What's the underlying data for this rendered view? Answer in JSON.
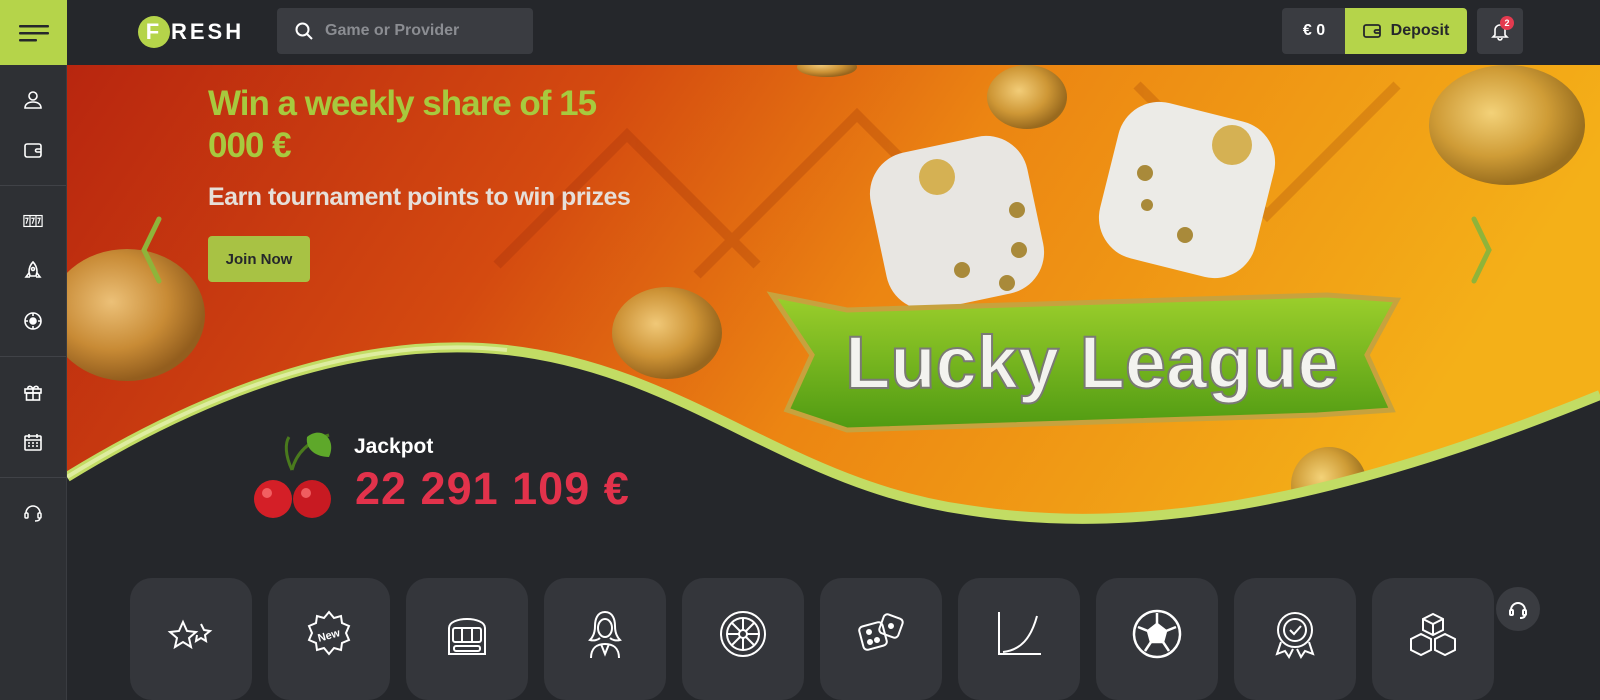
{
  "header": {
    "logo_letter": "F",
    "logo_rest": "RESH",
    "search_placeholder": "Game or Provider",
    "balance": "€ 0",
    "deposit_label": "Deposit",
    "notification_count": "2"
  },
  "sidebar": {
    "items": [
      {
        "icon": "user-icon"
      },
      {
        "icon": "wallet-icon"
      },
      {
        "icon": "slots-777-icon"
      },
      {
        "icon": "rocket-icon"
      },
      {
        "icon": "casino-chip-icon"
      },
      {
        "icon": "gift-icon"
      },
      {
        "icon": "calendar-icon"
      },
      {
        "icon": "support-24-icon"
      }
    ]
  },
  "banner": {
    "title": "Win a weekly share of 15 000 €",
    "subtitle": "Earn tournament points to win prizes",
    "cta": "Join Now",
    "league_name": "Lucky League",
    "jackpot_label": "Jackpot",
    "jackpot_value": "22 291 109 €"
  },
  "categories": [
    {
      "icon": "stars-icon"
    },
    {
      "icon": "new-badge-icon"
    },
    {
      "icon": "slot-machine-icon"
    },
    {
      "icon": "live-dealer-icon"
    },
    {
      "icon": "roulette-icon"
    },
    {
      "icon": "dice-icon"
    },
    {
      "icon": "crash-curve-icon"
    },
    {
      "icon": "football-icon"
    },
    {
      "icon": "award-badge-icon"
    },
    {
      "icon": "cubes-icon"
    }
  ],
  "colors": {
    "accent": "#b5d44a",
    "background": "#25272b",
    "jackpot": "#e2324b",
    "panel": "#34363b"
  }
}
